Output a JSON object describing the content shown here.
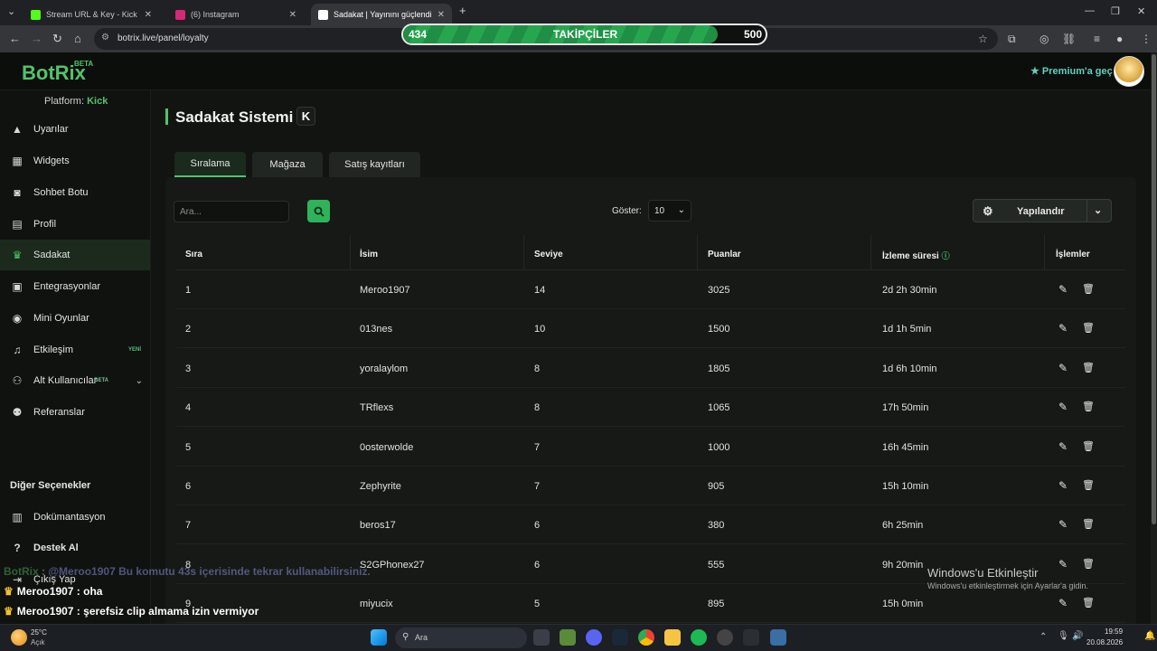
{
  "browser": {
    "tabs": [
      {
        "title": "Stream URL & Key - Kick Dashb",
        "color": "#53fc18",
        "active": false
      },
      {
        "title": "(6) Instagram",
        "color": "#d62976",
        "active": false
      },
      {
        "title": "Sadakat | Yayınını güçlendirmek",
        "color": "#ffffff",
        "active": true
      }
    ],
    "url": "botrix.live/panel/loyalty"
  },
  "overlay": {
    "follow_current": "434",
    "follow_label": "TAKİPÇİLER",
    "follow_goal": "500",
    "follow_progress": 0.868
  },
  "header": {
    "logo": "BotRix",
    "logo_badge": "BETA",
    "premium": "Premium'a geç",
    "accent": "#53c26b"
  },
  "sidebar": {
    "platform_label": "Platform:",
    "platform_value": "Kick",
    "items": [
      {
        "label": "Uyarılar",
        "icon": "warning-icon"
      },
      {
        "label": "Widgets",
        "icon": "grid-icon"
      },
      {
        "label": "Sohbet Botu",
        "icon": "robot-icon"
      },
      {
        "label": "Profil",
        "icon": "id-card-icon"
      },
      {
        "label": "Sadakat",
        "icon": "trophy-icon",
        "active": true
      },
      {
        "label": "Entegrasyonlar",
        "icon": "plug-icon"
      },
      {
        "label": "Mini Oyunlar",
        "icon": "gamepad-icon"
      },
      {
        "label": "Etkileşim",
        "icon": "music-icon",
        "badge": "YENİ"
      },
      {
        "label": "Alt Kullanıcılar",
        "icon": "users-icon",
        "badge": "BETA"
      },
      {
        "label": "Referanslar",
        "icon": "handshake-icon"
      }
    ],
    "other_heading": "Diğer Seçenekler",
    "other_items": [
      {
        "label": "Dokümantasyon",
        "icon": "book-icon"
      },
      {
        "label": "Destek Al",
        "icon": "help-icon"
      },
      {
        "label": "Çıkış Yap",
        "icon": "logout-icon"
      }
    ]
  },
  "page": {
    "title": "Sadakat Sistemi",
    "platform_badge": "K",
    "tabs": [
      "Sıralama",
      "Mağaza",
      "Satış kayıtları"
    ],
    "search_placeholder": "Ara...",
    "show_label": "Göster:",
    "show_value": "10",
    "configure_label": "Yapılandır",
    "columns": [
      "Sıra",
      "İsim",
      "Seviye",
      "Puanlar",
      "İzleme süresi",
      "İşlemler"
    ],
    "rows": [
      [
        "1",
        "Meroo1907",
        "14",
        "3025",
        "2d 2h 30min"
      ],
      [
        "2",
        "013nes",
        "10",
        "1500",
        "1d 1h 5min"
      ],
      [
        "3",
        "yoralaylom",
        "8",
        "1805",
        "1d 6h 10min"
      ],
      [
        "4",
        "TRflexs",
        "8",
        "1065",
        "17h 50min"
      ],
      [
        "5",
        "0osterwolde",
        "7",
        "1000",
        "16h 45min"
      ],
      [
        "6",
        "Zephyrite",
        "7",
        "905",
        "15h 10min"
      ],
      [
        "7",
        "beros17",
        "6",
        "380",
        "6h 25min"
      ],
      [
        "8",
        "S2GPhonex27",
        "6",
        "555",
        "9h 20min"
      ],
      [
        "9",
        "miyucix",
        "5",
        "895",
        "15h 0min"
      ]
    ]
  },
  "chat": [
    {
      "user": "BotRix",
      "text": "@Meroo1907 Bu komutu 43s içerisinde tekrar kullanabilirsiniz.",
      "faded": true
    },
    {
      "user": "Meroo1907",
      "text": "oha"
    },
    {
      "user": "Meroo1907",
      "text": "şerefsiz clip almama izin vermiyor"
    }
  ],
  "windows": {
    "activate_title": "Windows'u Etkinleştir",
    "activate_sub": "Windows'u etkinleştirmek için Ayarlar'a gidin.",
    "weather_temp": "25°C",
    "weather_cond": "Açık",
    "search": "Ara",
    "time": "19:59",
    "date": "20.08.2026"
  }
}
